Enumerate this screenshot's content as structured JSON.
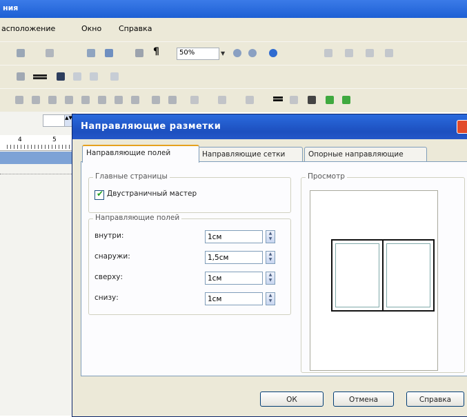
{
  "app": {
    "title_fragment": "ния",
    "menu": [
      "асположение",
      "Окно",
      "Справка"
    ],
    "zoom_value": "50%"
  },
  "sidebar": {
    "ruler_marks": [
      "4",
      "5"
    ]
  },
  "dialog": {
    "title": "Направляющие разметки",
    "tabs": [
      {
        "label": "Направляющие полей",
        "active": true
      },
      {
        "label": "Направляющие сетки",
        "active": false
      },
      {
        "label": "Опорные направляющие",
        "active": false
      }
    ],
    "main_pages_group": {
      "label": "Главные страницы",
      "two_page_master_label": "Двустраничный мастер",
      "two_page_master_checked": true
    },
    "margin_guides_group": {
      "label": "Направляющие полей",
      "fields": [
        {
          "label": "внутри:",
          "value": "1см"
        },
        {
          "label": "снаружи:",
          "value": "1,5см"
        },
        {
          "label": "сверху:",
          "value": "1см"
        },
        {
          "label": "снизу:",
          "value": "1см"
        }
      ]
    },
    "preview_label": "Просмотр",
    "buttons": {
      "ok": "ОК",
      "cancel": "Отмена",
      "help": "Справка"
    }
  },
  "colors": {
    "titlebar": "#1d5fd4",
    "dialog_face": "#ece9d8",
    "check_tick": "#21a121",
    "active_tab_accent": "#e6a11d"
  }
}
